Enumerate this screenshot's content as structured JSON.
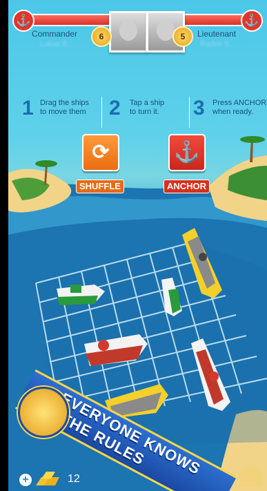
{
  "players": {
    "left": {
      "rank": "Commander",
      "level": "6",
      "name": "Lukas B."
    },
    "right": {
      "rank": "Lieutenant",
      "level": "5",
      "name": "Radek S."
    }
  },
  "instructions": [
    {
      "number": "1",
      "text_line1": "Drag the ships",
      "text_line2": "to move them"
    },
    {
      "number": "2",
      "text_line1": "Tap a ship",
      "text_line2": "to turn it."
    },
    {
      "number": "3",
      "text_line1": "Press ANCHOR",
      "text_line2": "when ready."
    }
  ],
  "buttons": {
    "shuffle_label": "SHUFFLE",
    "anchor_label": "ANCHOR"
  },
  "banner": {
    "line1": "EVERYONE KNOWS",
    "line2": "THE RULES"
  },
  "currency": {
    "gold_count": "12"
  },
  "colors": {
    "shuffle": "#f27a1a",
    "anchor": "#e0362b",
    "banner": "#1f56b8",
    "banner_trim": "#ffd649"
  },
  "icons": {
    "shuffle": "shuffle-arrows-icon",
    "anchor": "anchor-icon",
    "plus": "plus-icon",
    "gold": "gold-bars-icon"
  }
}
